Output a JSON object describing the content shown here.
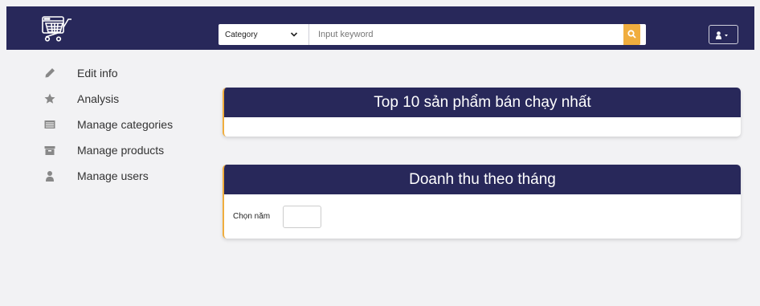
{
  "navbar": {
    "logo_icon": "shopping-cart-screen-logo",
    "category_select": "Category",
    "keyword_placeholder": "Input keyword",
    "search_icon": "search-icon",
    "user_icon": "user-icon",
    "accent_color": "#f0ad3e",
    "brand_color": "#28285a"
  },
  "sidebar": {
    "items": [
      {
        "label": "Edit info",
        "icon": "pencil-icon"
      },
      {
        "label": "Analysis",
        "icon": "star-icon"
      },
      {
        "label": "Manage categories",
        "icon": "list-icon"
      },
      {
        "label": "Manage products",
        "icon": "archive-box-icon"
      },
      {
        "label": "Manage users",
        "icon": "user-icon"
      }
    ]
  },
  "main": {
    "top_products_title": "Top 10 sản phẩm bán chạy nhất",
    "revenue_title": "Doanh thu theo tháng",
    "year_label": "Chọn năm",
    "year_value": ""
  }
}
